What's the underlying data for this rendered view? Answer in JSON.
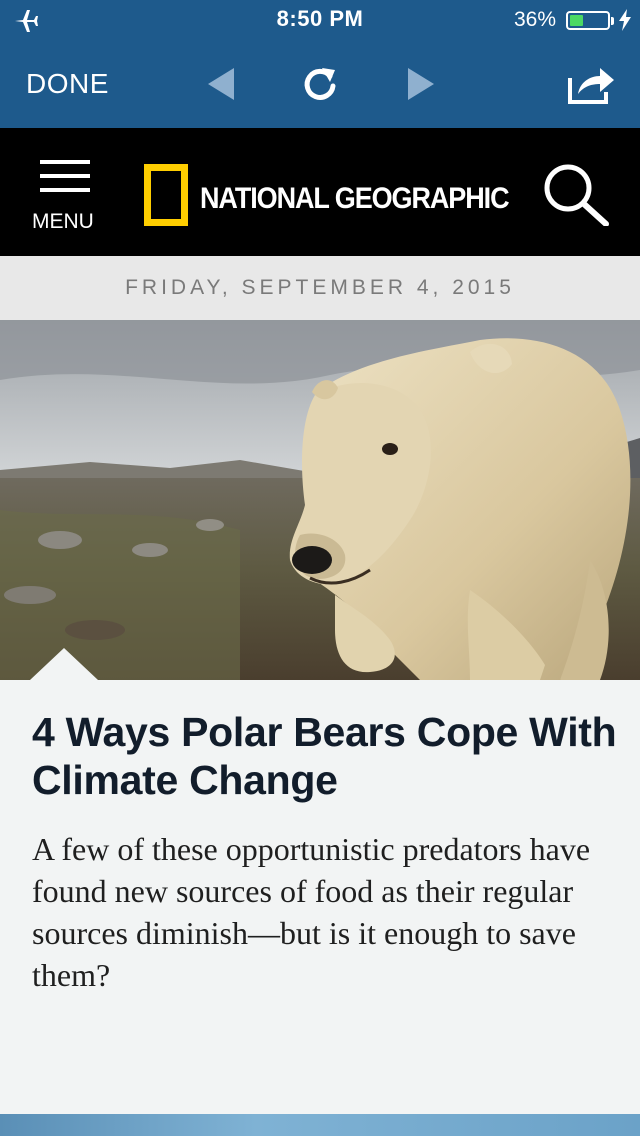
{
  "status_bar": {
    "time": "8:50 PM",
    "battery_percent": "36%",
    "battery_level": 0.36
  },
  "toolbar": {
    "done_label": "DONE"
  },
  "header": {
    "menu_label": "MENU",
    "brand": "NATIONAL GEOGRAPHIC",
    "brand_accent_color": "#ffce00"
  },
  "date": "FRIDAY, SEPTEMBER 4, 2015",
  "article": {
    "headline": "4 Ways Polar Bears Cope With Climate Change",
    "dek": "A few of these opportunistic predators have found new sources of food as their regular sources diminish—but is it enough to save them?"
  },
  "colors": {
    "toolbar_bg": "#1e5a8c",
    "header_bg": "#000000",
    "page_bg": "#f2f4f4"
  }
}
